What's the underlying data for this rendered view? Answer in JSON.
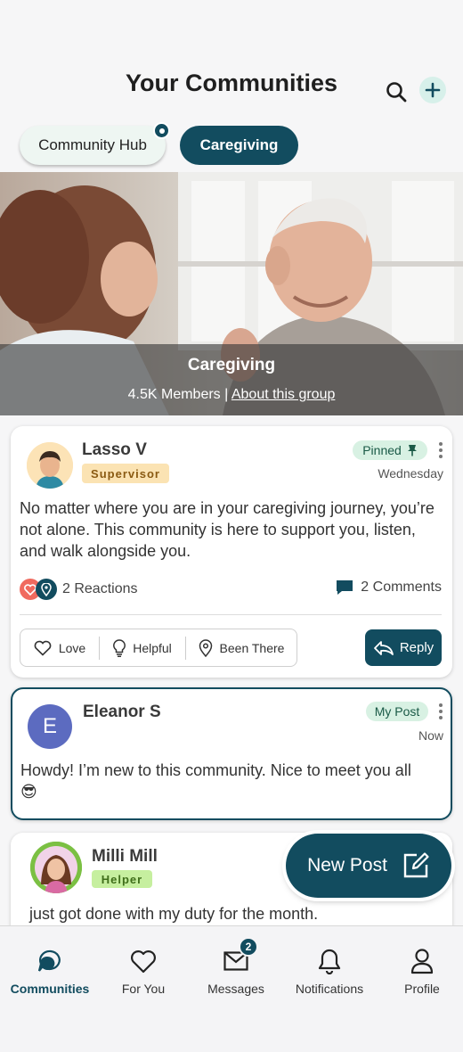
{
  "header": {
    "title": "Your Communities"
  },
  "chips": {
    "hub": "Community Hub",
    "caregiving": "Caregiving"
  },
  "banner": {
    "name": "Caregiving",
    "members": "4.5K Members",
    "separator": "|",
    "about_link": "About this group"
  },
  "posts": [
    {
      "author": "Lasso V",
      "role": "Supervisor",
      "pill": "Pinned",
      "time": "Wednesday",
      "body": "No matter where you are in your caregiving journey, you’re not alone. This community is here to support you, listen, and walk alongside you.",
      "reactions": "2 Reactions",
      "comments": "2 Comments",
      "actions": {
        "love": "Love",
        "helpful": "Helpful",
        "been_there": "Been There",
        "reply": "Reply"
      }
    },
    {
      "author": "Eleanor S",
      "avatar_letter": "E",
      "pill": "My Post",
      "time": "Now",
      "body": "Howdy! I’m new to this community. Nice to meet you all 😎"
    },
    {
      "author": "Milli Mill",
      "role": "Helper",
      "body": "just got done with my duty for the month."
    }
  ],
  "fab": {
    "label": "New Post"
  },
  "tabbar": {
    "communities": "Communities",
    "for_you": "For You",
    "messages": "Messages",
    "messages_badge": "2",
    "notifications": "Notifications",
    "profile": "Profile"
  },
  "colors": {
    "primary": "#124c5f",
    "supervisor_badge": "#fbe3b3",
    "helper_badge": "#c6ef9f",
    "pill_bg": "#d8f1e3"
  }
}
